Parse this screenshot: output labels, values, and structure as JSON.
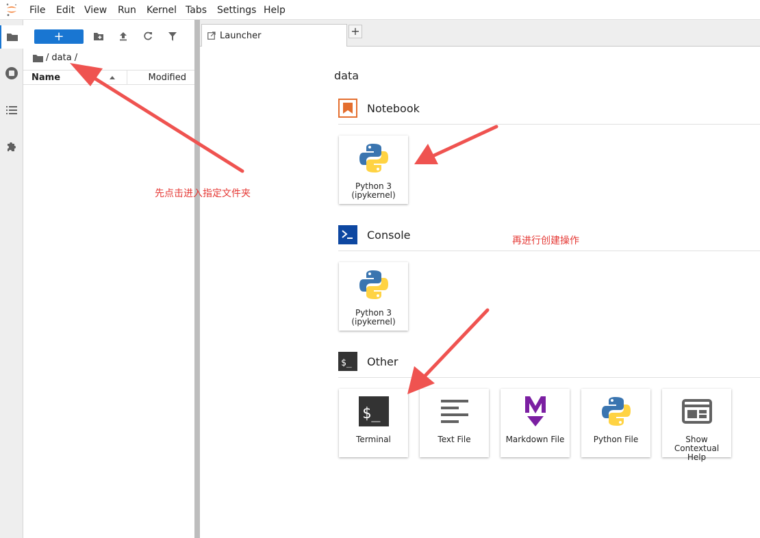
{
  "menubar": {
    "items": [
      "File",
      "Edit",
      "View",
      "Run",
      "Kernel",
      "Tabs",
      "Settings",
      "Help"
    ]
  },
  "activity_bar": {
    "icons": [
      "folder-icon",
      "running-icon",
      "toc-icon",
      "extension-icon"
    ]
  },
  "file_browser": {
    "new_label": "+",
    "breadcrumb": {
      "root": "/",
      "folder": "data",
      "trail": "/"
    },
    "columns": {
      "name": "Name",
      "modified": "Modified"
    }
  },
  "tabs": [
    {
      "label": "Launcher"
    }
  ],
  "tab_add": "+",
  "launcher": {
    "cwd": "data",
    "sections": {
      "notebook": {
        "title": "Notebook",
        "cards": [
          {
            "label": "Python 3\n(ipykernel)"
          }
        ]
      },
      "console": {
        "title": "Console",
        "cards": [
          {
            "label": "Python 3\n(ipykernel)"
          }
        ]
      },
      "other": {
        "title": "Other",
        "cards": [
          {
            "label": "Terminal"
          },
          {
            "label": "Text File"
          },
          {
            "label": "Markdown File"
          },
          {
            "label": "Python File"
          },
          {
            "label": "Show\nContextual\nHelp"
          }
        ]
      }
    }
  },
  "annotations": {
    "note1": "先点击进入指定文件夹",
    "note2": "再进行创建操作"
  },
  "colors": {
    "accent": "#1976d2",
    "annotation": "#e53935",
    "notebook_orange": "#e46e2e",
    "console_blue": "#0d47a1",
    "markdown_purple": "#7b1fa2"
  }
}
